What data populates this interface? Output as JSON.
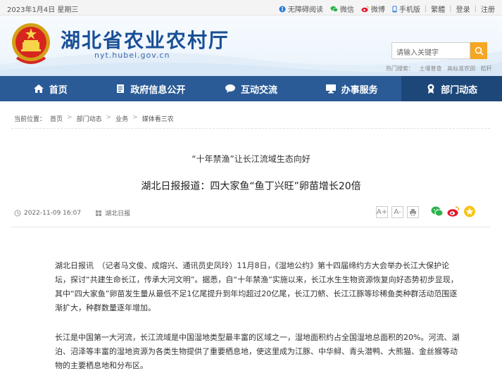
{
  "topbar": {
    "date": "2023年1月4日 星期三",
    "links": [
      "无障碍阅读",
      "微信",
      "微博",
      "手机版",
      "繁體",
      "登录",
      "注册"
    ]
  },
  "header": {
    "site_title": "湖北省农业农村厅",
    "site_url": "nyt.hubei.gov.cn",
    "search_placeholder": "请输入关键字",
    "hot_label": "热门搜索：",
    "hot_items": [
      "土壤普查",
      "高标准农田",
      "秸秆"
    ]
  },
  "nav": {
    "items": [
      "首页",
      "政府信息公开",
      "互动交流",
      "办事服务",
      "部门动态"
    ]
  },
  "breadcrumb": {
    "label": "当前位置：",
    "items": [
      "首页",
      "部门动态",
      "业务",
      "媒体看三农"
    ]
  },
  "article": {
    "subtitle": "“十年禁渔”让长江流域生态向好",
    "title": "湖北日报报道：四大家鱼“鱼丁兴旺”卵苗增长20倍",
    "date": "2022-11-09 16:07",
    "source": "湖北日报",
    "font_large": "A+",
    "font_small": "A-",
    "paragraphs": [
      "湖北日报讯　（记者马文俊、成熔兴、通讯员史凤玲）11月8日，《湿地公约》第十四届缔约方大会举办长江大保护论坛，探讨“共建生命长江，传承大河文明”。据悉，自“十年禁渔”实施以来，长江水生生物资源恢复向好态势初步显现，其中“四大家鱼”卵苗发生量从最低不足1亿尾提升到年均超过20亿尾，长江刀鲚、长江江豚等珍稀鱼类种群活动范围逐渐扩大，种群数量逐年增加。",
      "长江是中国第一大河流，长江流域是中国湿地类型最丰富的区域之一，湿地面积约占全国湿地总面积的20%。河流、湖泊、沼泽等丰富的湿地资源为各类生物提供了重要栖息地，使这里成为江豚、中华鲟、青头潜鸭、大熊猫、金丝猴等动物的主要栖息地和分布区。"
    ]
  }
}
